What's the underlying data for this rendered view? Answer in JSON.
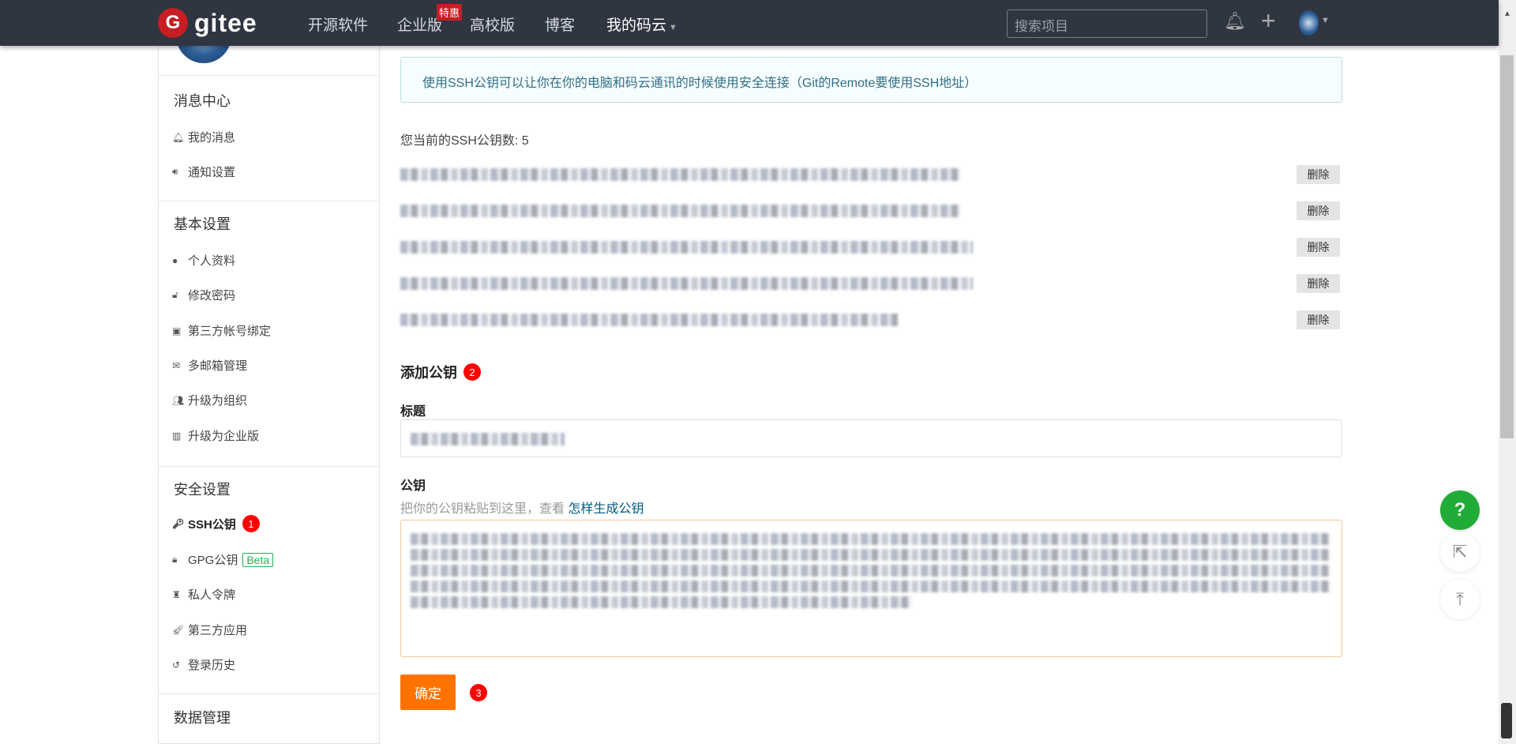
{
  "nav": {
    "logo_text": "gitee",
    "logo_letter": "G",
    "items": [
      "开源软件",
      "企业版",
      "高校版",
      "博客",
      "我的码云"
    ],
    "hot_badge": "特惠",
    "search_placeholder": "搜索项目"
  },
  "sidebar": {
    "sections": [
      {
        "title": "消息中心",
        "items": [
          "我的消息",
          "通知设置"
        ]
      },
      {
        "title": "基本设置",
        "items": [
          "个人资料",
          "修改密码",
          "第三方帐号绑定",
          "多邮箱管理",
          "升级为组织",
          "升级为企业版"
        ]
      },
      {
        "title": "安全设置",
        "items": [
          "SSH公钥",
          "GPG公钥",
          "私人令牌",
          "第三方应用",
          "登录历史"
        ]
      },
      {
        "title": "数据管理",
        "items": []
      }
    ],
    "beta_label": "Beta",
    "step_badge": "1"
  },
  "main": {
    "info": "使用SSH公钥可以让你在你的电脑和码云通讯的时候使用安全连接（Git的Remote要使用SSH地址）",
    "count_label": "您当前的SSH公钥数: 5",
    "delete_label": "删除",
    "add_title": "添加公钥",
    "add_badge": "2",
    "title_label": "标题",
    "key_label": "公钥",
    "hint_text": "把你的公钥粘贴到这里，查看 ",
    "hint_link": "怎样生成公钥",
    "submit_label": "确定",
    "submit_badge": "3"
  },
  "float": {
    "help": "?"
  }
}
